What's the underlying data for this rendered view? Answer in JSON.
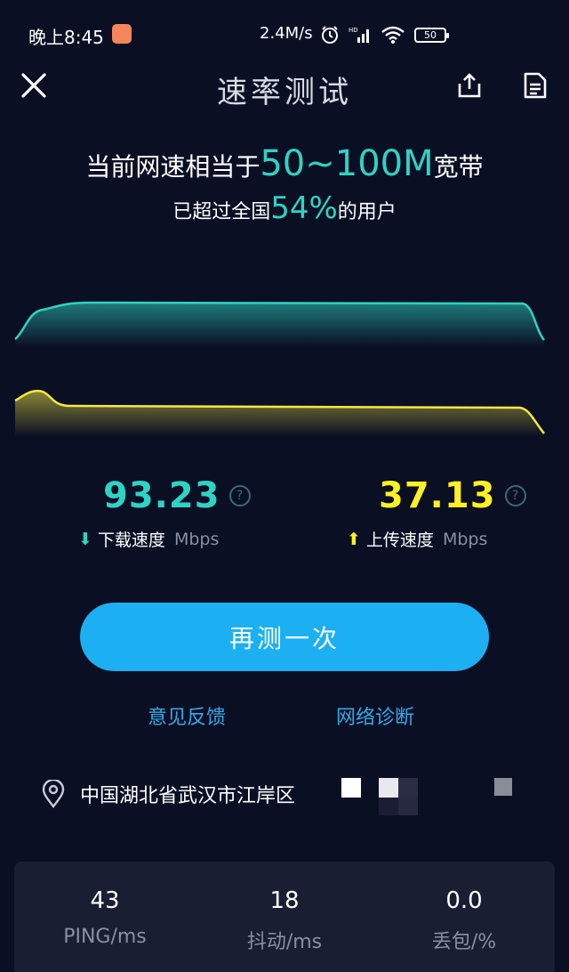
{
  "status_bar": {
    "time": "晚上8:45",
    "net_speed": "2.4M/s",
    "battery": "50",
    "icons": [
      "alarm-icon",
      "hd-signal-icon",
      "wifi-icon",
      "battery-icon"
    ]
  },
  "header": {
    "title": "速率测试",
    "icons": [
      "close-icon",
      "share-icon",
      "report-icon"
    ]
  },
  "summary": {
    "line1_prefix": "当前网速相当于",
    "line1_value": "50~100M",
    "line1_suffix": "宽带",
    "line2_prefix": "已超过全国",
    "line2_value": "54%",
    "line2_suffix": "的用户"
  },
  "graph": {
    "download_color": "#2ed3c3",
    "upload_color": "#f4e842"
  },
  "download": {
    "value": "93.23",
    "label": "下载速度",
    "unit": "Mbps",
    "color": "#2ed3c3",
    "arrow": "⬇"
  },
  "upload": {
    "value": "37.13",
    "label": "上传速度",
    "unit": "Mbps",
    "color": "#fcf221",
    "arrow": "⬆"
  },
  "actions": {
    "retest_label": "再测一次",
    "feedback_label": "意见反馈",
    "diagnose_label": "网络诊断"
  },
  "location": {
    "text": "中国湖北省武汉市江岸区"
  },
  "metrics": [
    {
      "value": "43",
      "label": "PING/ms"
    },
    {
      "value": "18",
      "label": "抖动/ms"
    },
    {
      "value": "0.0",
      "label": "丢包/%"
    }
  ],
  "colors": {
    "background": "#0b0f24",
    "accent_teal": "#2ed3c3",
    "accent_yellow": "#fcf221",
    "button_blue": "#1cb0f2",
    "link_blue": "#33a9e8"
  }
}
